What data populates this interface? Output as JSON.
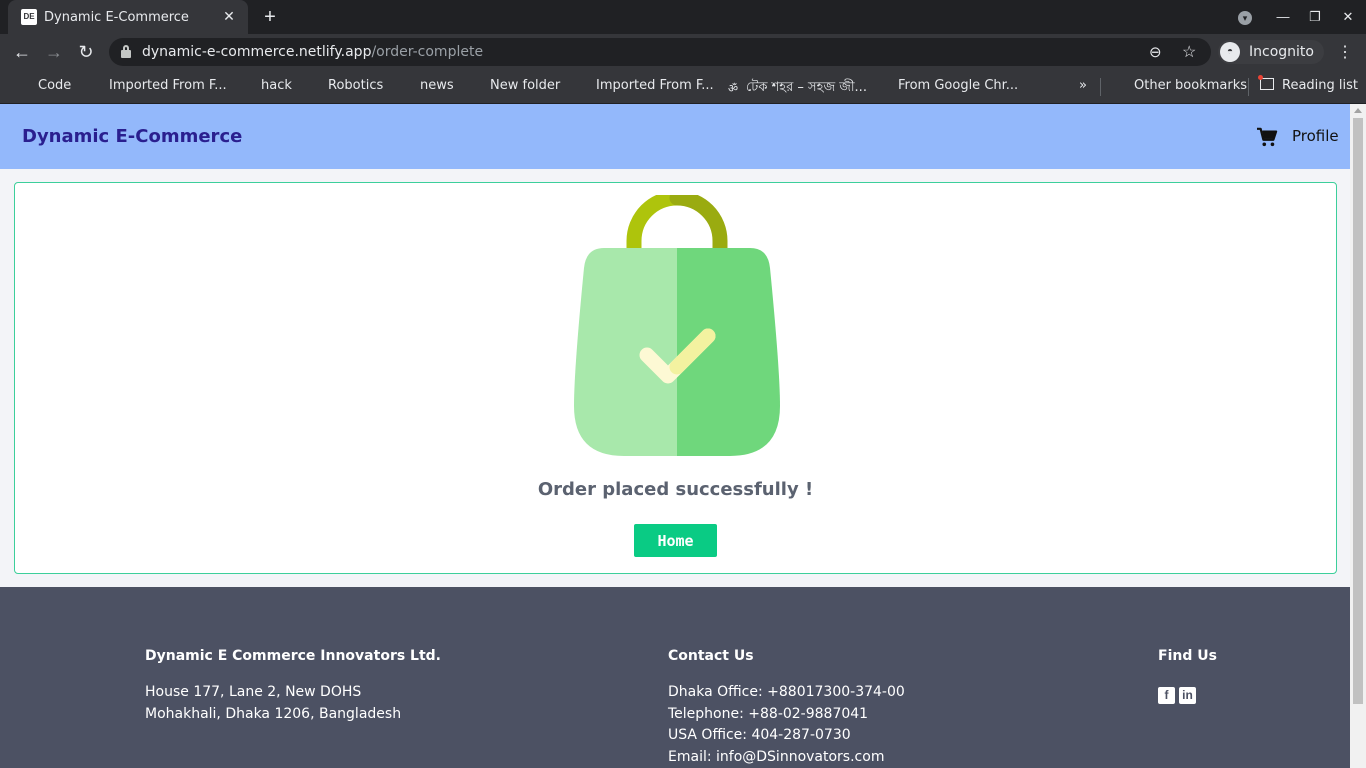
{
  "browser": {
    "tab_title": "Dynamic E-Commerce",
    "favicon_text": "DE",
    "url_host": "dynamic-e-commerce.netlify.app",
    "url_path": "/order-complete",
    "profile_label": "Incognito",
    "bookmarks": [
      "Code",
      "Imported From F...",
      "hack",
      "Robotics",
      "news",
      "New folder",
      "Imported From F...",
      "টেক শহর – সহজ জী...",
      "From Google Chr..."
    ],
    "more_bookmarks": "»",
    "other_bookmarks": "Other bookmarks",
    "reading_list": "Reading list"
  },
  "header": {
    "brand": "Dynamic E-Commerce",
    "profile": "Profile"
  },
  "order": {
    "message": "Order placed successfully !",
    "home_button": "Home"
  },
  "footer": {
    "company": {
      "title": "Dynamic E Commerce Innovators Ltd.",
      "address_line1": "House 177, Lane 2, New DOHS",
      "address_line2": "Mohakhali, Dhaka 1206, Bangladesh"
    },
    "contact": {
      "title": "Contact Us",
      "dhaka": "Dhaka Office: +88017300-374-00",
      "telephone": "Telephone: +88-02-9887041",
      "usa": "USA Office: 404-287-0730",
      "email": "Email: info@DSinnovators.com"
    },
    "find": {
      "title": "Find Us",
      "icons": [
        "facebook-icon",
        "linkedin-icon"
      ]
    }
  },
  "colors": {
    "header_bg": "#93b8fb",
    "brand_text": "#2a1f8f",
    "card_border": "#3ccf9b",
    "button_bg": "#0acb84",
    "footer_bg": "#4c5163"
  }
}
